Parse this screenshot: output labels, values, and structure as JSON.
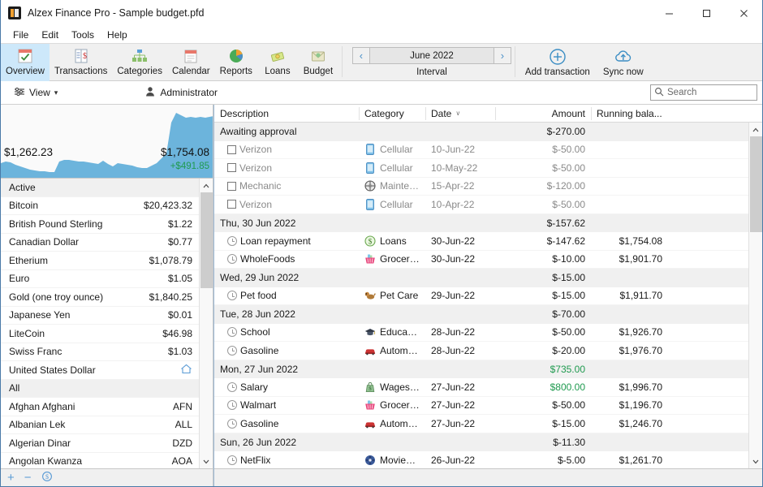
{
  "window": {
    "title": "Alzex Finance Pro - Sample budget.pfd",
    "app_icon": "app-icon",
    "controls": {
      "minimize": "—",
      "maximize": "❑",
      "close": "✕"
    }
  },
  "menubar": {
    "items": [
      "File",
      "Edit",
      "Tools",
      "Help"
    ]
  },
  "ribbon": {
    "tabs": [
      {
        "label": "Overview",
        "icon": "overview-checklist-icon",
        "active": true
      },
      {
        "label": "Transactions",
        "icon": "transactions-ledger-icon",
        "active": false
      },
      {
        "label": "Categories",
        "icon": "categories-tree-icon",
        "active": false
      },
      {
        "label": "Calendar",
        "icon": "calendar-icon",
        "active": false
      },
      {
        "label": "Reports",
        "icon": "reports-piechart-icon",
        "active": false
      },
      {
        "label": "Loans",
        "icon": "loans-money-icon",
        "active": false
      },
      {
        "label": "Budget",
        "icon": "budget-envelope-icon",
        "active": false
      }
    ],
    "interval": {
      "prev": "‹",
      "next": "›",
      "value": "June 2022",
      "label": "Interval"
    },
    "commands": [
      {
        "label": "Add transaction",
        "icon": "plus-circle-icon"
      },
      {
        "label": "Sync now",
        "icon": "cloud-upload-icon"
      }
    ]
  },
  "viewbar": {
    "view_label": "View",
    "view_icon": "sliders-icon",
    "chevron": "▾",
    "user_icon": "user-icon",
    "user_name": "Administrator",
    "search": {
      "placeholder": "Search",
      "icon": "search-icon",
      "value": ""
    }
  },
  "sidebar": {
    "sparkline": {
      "start_value": "$1,262.23",
      "end_value": "$1,754.08",
      "delta": "+$491.85",
      "delta_color": "#1f9a4f",
      "fill_color": "#6cb4dc"
    },
    "sections": [
      {
        "header": "Active",
        "items": [
          {
            "label": "Bitcoin",
            "value": "$20,423.32"
          },
          {
            "label": "British Pound Sterling",
            "value": "$1.22"
          },
          {
            "label": "Canadian Dollar",
            "value": "$0.77"
          },
          {
            "label": "Etherium",
            "value": "$1,078.79"
          },
          {
            "label": "Euro",
            "value": "$1.05"
          },
          {
            "label": "Gold (one troy ounce)",
            "value": "$1,840.25"
          },
          {
            "label": "Japanese Yen",
            "value": "$0.01"
          },
          {
            "label": "LiteCoin",
            "value": "$46.98"
          },
          {
            "label": "Swiss Franc",
            "value": "$1.03"
          },
          {
            "label": "United States Dollar",
            "value": "",
            "icon": "home-icon"
          }
        ]
      },
      {
        "header": "All",
        "items": [
          {
            "label": "Afghan Afghani",
            "value": "AFN"
          },
          {
            "label": "Albanian Lek",
            "value": "ALL"
          },
          {
            "label": "Algerian Dinar",
            "value": "DZD"
          },
          {
            "label": "Angolan Kwanza",
            "value": "AOA"
          }
        ]
      }
    ],
    "footer": {
      "add": "+",
      "remove": "−",
      "refresh_icon": "currency-refresh-icon",
      "search_icon": "search-icon",
      "favorite_icon": "star-icon",
      "add2": "+",
      "remove2": "−"
    }
  },
  "table": {
    "columns": [
      {
        "key": "description",
        "label": "Description",
        "align": "left"
      },
      {
        "key": "category",
        "label": "Category",
        "align": "left"
      },
      {
        "key": "date",
        "label": "Date",
        "align": "left",
        "sort": "∨"
      },
      {
        "key": "amount",
        "label": "Amount",
        "align": "right"
      },
      {
        "key": "balance",
        "label": "Running bala...",
        "align": "right"
      }
    ],
    "rows": [
      {
        "type": "group",
        "label": "Awaiting approval",
        "amount": "$-270.00",
        "positive": false
      },
      {
        "type": "data",
        "pending": true,
        "check": true,
        "description": "Verizon",
        "category": "Cellular",
        "cat_icon": "phone-icon",
        "date": "10-Jun-22",
        "amount": "$-50.00",
        "positive": false,
        "balance": ""
      },
      {
        "type": "data",
        "pending": true,
        "check": true,
        "description": "Verizon",
        "category": "Cellular",
        "cat_icon": "phone-icon",
        "date": "10-May-22",
        "amount": "$-50.00",
        "positive": false,
        "balance": ""
      },
      {
        "type": "data",
        "pending": true,
        "check": true,
        "description": "Mechanic",
        "category": "Maintenan...",
        "cat_icon": "maintenance-icon",
        "date": "15-Apr-22",
        "amount": "$-120.00",
        "positive": false,
        "balance": ""
      },
      {
        "type": "data",
        "pending": true,
        "check": true,
        "description": "Verizon",
        "category": "Cellular",
        "cat_icon": "phone-icon",
        "date": "10-Apr-22",
        "amount": "$-50.00",
        "positive": false,
        "balance": ""
      },
      {
        "type": "group",
        "label": "Thu, 30 Jun 2022",
        "amount": "$-157.62",
        "positive": false
      },
      {
        "type": "data",
        "pending": false,
        "check": false,
        "description": "Loan repayment",
        "category": "Loans",
        "cat_icon": "loan-dollar-icon",
        "date": "30-Jun-22",
        "amount": "$-147.62",
        "positive": false,
        "balance": "$1,754.08"
      },
      {
        "type": "data",
        "pending": false,
        "check": false,
        "description": "WholeFoods",
        "category": "Groceries",
        "cat_icon": "groceries-icon",
        "date": "30-Jun-22",
        "amount": "$-10.00",
        "positive": false,
        "balance": "$1,901.70"
      },
      {
        "type": "group",
        "label": "Wed, 29 Jun 2022",
        "amount": "$-15.00",
        "positive": false
      },
      {
        "type": "data",
        "pending": false,
        "check": false,
        "description": "Pet food",
        "category": "Pet Care",
        "cat_icon": "dog-icon",
        "date": "29-Jun-22",
        "amount": "$-15.00",
        "positive": false,
        "balance": "$1,911.70"
      },
      {
        "type": "group",
        "label": "Tue, 28 Jun 2022",
        "amount": "$-70.00",
        "positive": false
      },
      {
        "type": "data",
        "pending": false,
        "check": false,
        "description": "School",
        "category": "Education",
        "cat_icon": "graduation-icon",
        "date": "28-Jun-22",
        "amount": "$-50.00",
        "positive": false,
        "balance": "$1,926.70"
      },
      {
        "type": "data",
        "pending": false,
        "check": false,
        "description": "Gasoline",
        "category": "Automobi...",
        "cat_icon": "car-icon",
        "date": "28-Jun-22",
        "amount": "$-20.00",
        "positive": false,
        "balance": "$1,976.70"
      },
      {
        "type": "group",
        "label": "Mon, 27 Jun 2022",
        "amount": "$735.00",
        "positive": true
      },
      {
        "type": "data",
        "pending": false,
        "check": false,
        "description": "Salary",
        "category": "Wages ar...",
        "cat_icon": "wages-icon",
        "date": "27-Jun-22",
        "amount": "$800.00",
        "positive": true,
        "balance": "$1,996.70"
      },
      {
        "type": "data",
        "pending": false,
        "check": false,
        "description": "Walmart",
        "category": "Groceries",
        "cat_icon": "groceries-icon",
        "date": "27-Jun-22",
        "amount": "$-50.00",
        "positive": false,
        "balance": "$1,196.70"
      },
      {
        "type": "data",
        "pending": false,
        "check": false,
        "description": "Gasoline",
        "category": "Automobi...",
        "cat_icon": "car-icon",
        "date": "27-Jun-22",
        "amount": "$-15.00",
        "positive": false,
        "balance": "$1,246.70"
      },
      {
        "type": "group",
        "label": "Sun, 26 Jun 2022",
        "amount": "$-11.30",
        "positive": false
      },
      {
        "type": "data",
        "pending": false,
        "check": false,
        "description": "NetFlix",
        "category": "Movies &...",
        "cat_icon": "movies-icon",
        "date": "26-Jun-22",
        "amount": "$-5.00",
        "positive": false,
        "balance": "$1,261.70"
      }
    ]
  }
}
